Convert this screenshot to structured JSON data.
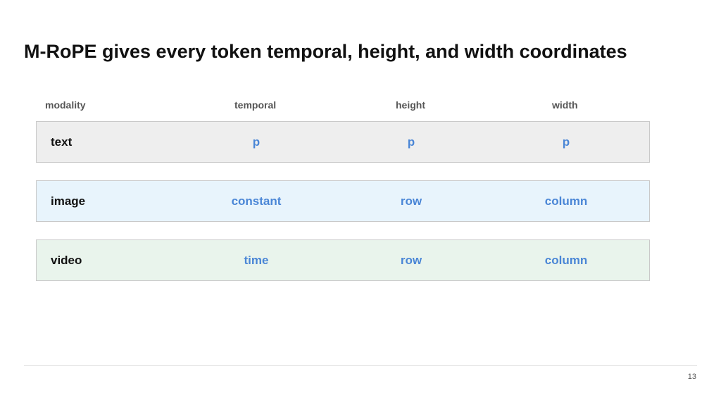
{
  "title": "M-RoPE gives every token temporal, height, and width coordinates",
  "table": {
    "headers": [
      "modality",
      "temporal",
      "height",
      "width"
    ],
    "rows": [
      {
        "modality": "text",
        "temporal": "p",
        "height": "p",
        "width": "p",
        "color": "#eeeeee"
      },
      {
        "modality": "image",
        "temporal": "constant",
        "height": "row",
        "width": "column",
        "color": "#e8f4fc"
      },
      {
        "modality": "video",
        "temporal": "time",
        "height": "row",
        "width": "column",
        "color": "#e9f4ec"
      }
    ]
  },
  "colors": {
    "value_text": "#4a86d6",
    "label_text": "#111111",
    "header_text": "#555555"
  },
  "page_number": "13"
}
